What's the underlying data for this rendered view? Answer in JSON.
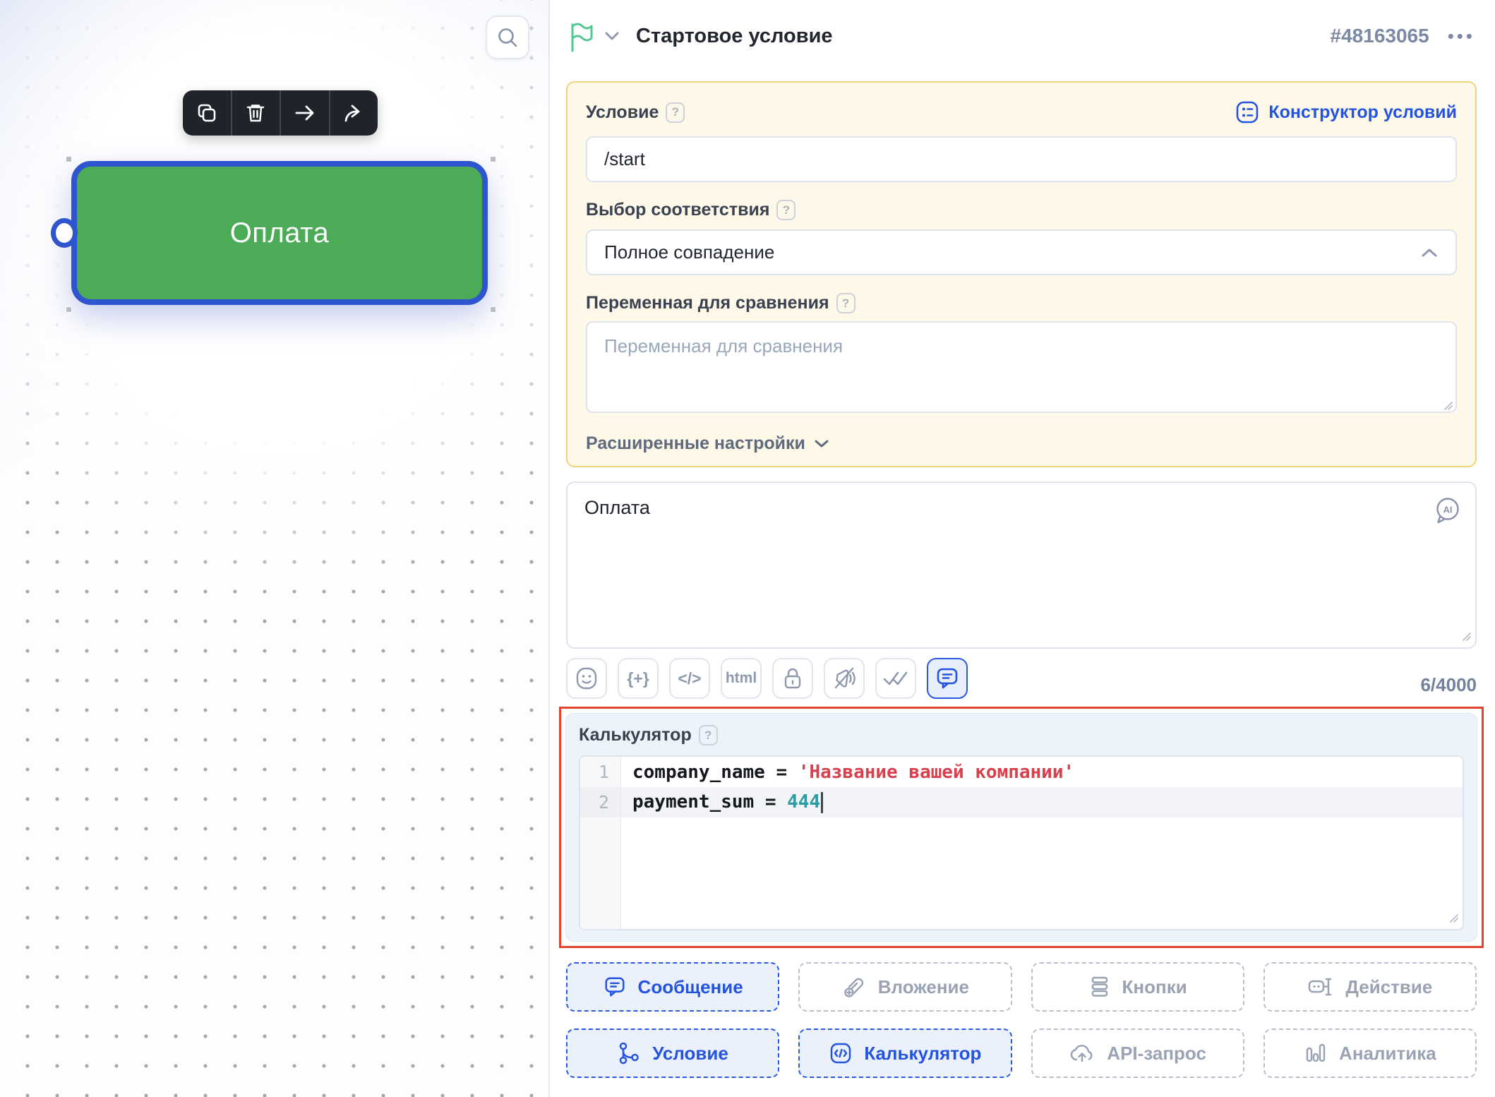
{
  "canvas": {
    "node_label": "Оплата",
    "toolbar_icons": [
      "copy-icon",
      "trash-icon",
      "arrow-right-icon",
      "share-icon"
    ],
    "search_icon": "search-icon"
  },
  "header": {
    "type_icon": "flag-icon",
    "title": "Стартовое условие",
    "id": "#48163065",
    "menu": "•••"
  },
  "condition": {
    "label": "Условие",
    "help": "?",
    "constructor_link": "Конструктор условий",
    "value": "/start",
    "match_label": "Выбор соответствия",
    "match_help": "?",
    "match_value": "Полное совпадение",
    "variable_label": "Переменная для сравнения",
    "variable_help": "?",
    "variable_placeholder": "Переменная для сравнения",
    "advanced_label": "Расширенные настройки"
  },
  "message": {
    "text": "Оплата",
    "ai_badge": "AI",
    "counter": "6/4000",
    "tool_labels": {
      "variable": "{+}",
      "code": "</>",
      "html": "html"
    },
    "tools": [
      "emoji-icon",
      "variable-icon",
      "code-icon",
      "html-icon",
      "lock-icon",
      "voice-off-icon",
      "double-check-icon",
      "comment-icon"
    ]
  },
  "calculator": {
    "label": "Калькулятор",
    "help": "?",
    "lines": [
      {
        "n": "1",
        "plain": "company_name = ",
        "string": "'Название вашей компании'"
      },
      {
        "n": "2",
        "plain": "payment_sum = ",
        "number": "444"
      }
    ]
  },
  "actions": {
    "row1": [
      {
        "label": "Сообщение",
        "state": "active",
        "icon": "message-icon"
      },
      {
        "label": "Вложение",
        "state": "default",
        "icon": "attachment-icon"
      },
      {
        "label": "Кнопки",
        "state": "default",
        "icon": "buttons-icon"
      },
      {
        "label": "Действие",
        "state": "default",
        "icon": "action-robot-icon"
      }
    ],
    "row2": [
      {
        "label": "Условие",
        "state": "active",
        "icon": "condition-branch-icon"
      },
      {
        "label": "Калькулятор",
        "state": "active",
        "icon": "calculator-icon"
      },
      {
        "label": "API-запрос",
        "state": "default",
        "icon": "api-cloud-icon"
      },
      {
        "label": "Аналитика",
        "state": "default",
        "icon": "analytics-icon"
      }
    ]
  },
  "colors": {
    "accent_blue": "#2353df",
    "node_green": "#4cab57",
    "node_border_blue": "#2f54cf",
    "highlight_red": "#e2442f",
    "yellow_border": "#f0d37e",
    "yellow_bg": "#fdf8e8",
    "calc_bg": "#ecf3fb",
    "string_red": "#d8404d",
    "number_teal": "#2e9ba0",
    "flag_green": "#52c78f"
  }
}
